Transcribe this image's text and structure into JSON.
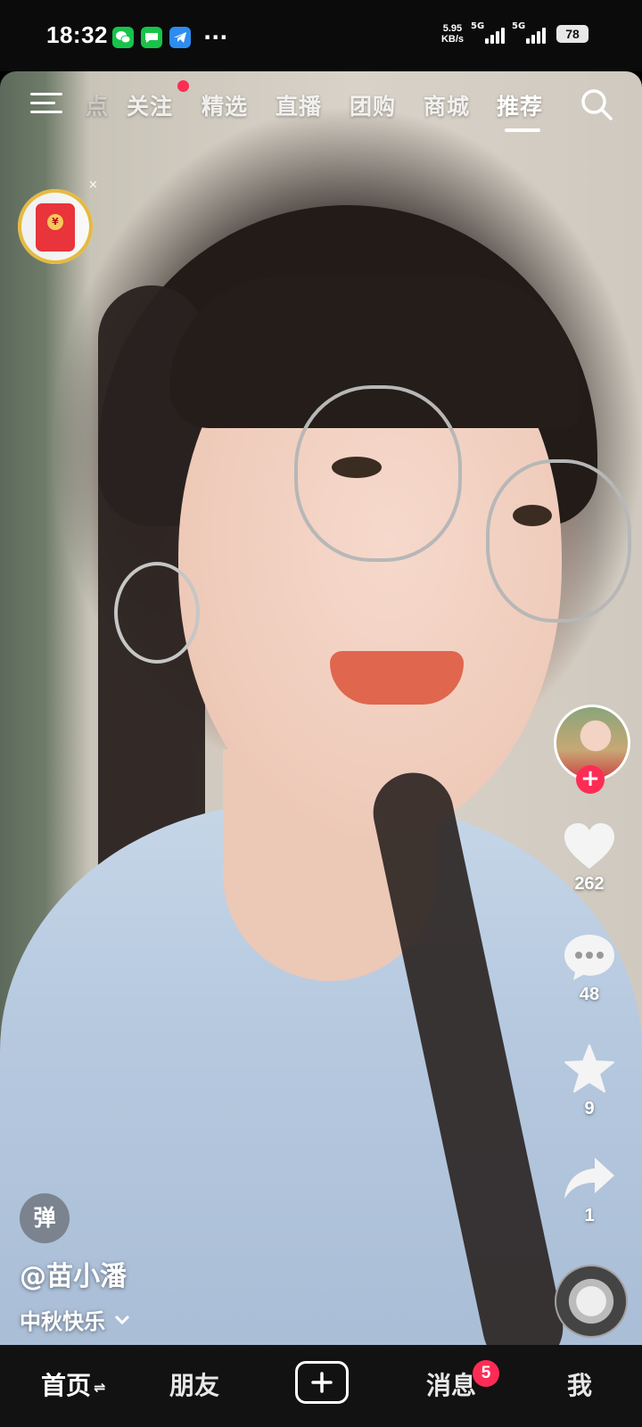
{
  "status_bar": {
    "time": "18:32",
    "net_speed_value": "5.95",
    "net_speed_unit": "KB/s",
    "signal1_label": "5G",
    "signal2_label": "5G",
    "battery": "78",
    "more": "···"
  },
  "top_tabs": {
    "partial": "点",
    "follow": "关注",
    "featured": "精选",
    "live": "直播",
    "group_buy": "团购",
    "mall": "商城",
    "recommend": "推荐"
  },
  "red_packet": {
    "seal": "¥",
    "close": "×"
  },
  "right_rail": {
    "like_count": "262",
    "comment_count": "48",
    "favorite_count": "9",
    "share_count": "1",
    "follow_symbol": "+"
  },
  "video_info": {
    "danmu": "弹",
    "author": "@苗小潘",
    "caption": "中秋快乐"
  },
  "bottom_nav": {
    "home": "首页",
    "home_switch": "⇌",
    "friends": "朋友",
    "messages": "消息",
    "messages_badge": "5",
    "me": "我"
  },
  "colors": {
    "accent_red": "#fe2c55",
    "nav_bg": "#121212",
    "status_bg": "#0b0b0b"
  }
}
